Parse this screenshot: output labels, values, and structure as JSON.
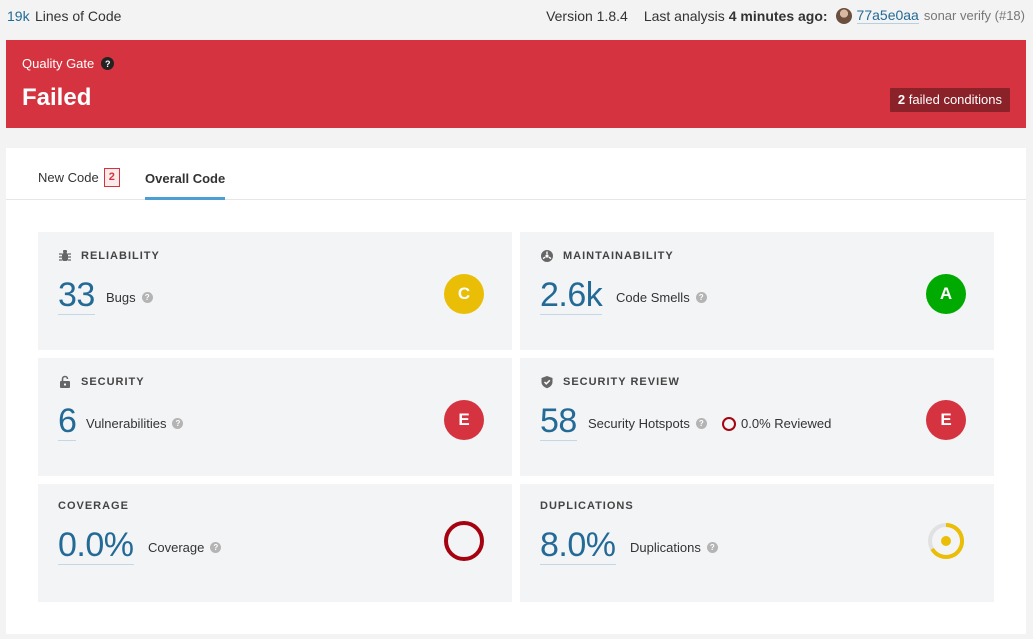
{
  "topbar": {
    "loc_value": "19k",
    "loc_label": "Lines of Code",
    "version": "Version 1.8.4",
    "last_analysis_label": "Last analysis",
    "last_analysis_ago": "4 minutes ago:",
    "commit": "77a5e0aa",
    "branch_note": "sonar verify (#18)",
    "avatar_icon": "user-avatar"
  },
  "quality_gate": {
    "label": "Quality Gate",
    "help": "?",
    "status": "Failed",
    "failed_count": "2",
    "failed_text": "failed conditions",
    "color": "#d4333f"
  },
  "tabs": {
    "new_code": "New Code",
    "new_code_badge": "2",
    "overall_code": "Overall Code",
    "active": "overall_code"
  },
  "cards": {
    "reliability": {
      "title": "RELIABILITY",
      "icon": "bug-icon",
      "value": "33",
      "label": "Bugs",
      "rating": "C",
      "rating_color": "#eabe06"
    },
    "maintainability": {
      "title": "MAINTAINABILITY",
      "icon": "smell-icon",
      "value": "2.6k",
      "label": "Code Smells",
      "rating": "A",
      "rating_color": "#00aa00"
    },
    "security": {
      "title": "SECURITY",
      "icon": "lock-icon",
      "value": "6",
      "label": "Vulnerabilities",
      "rating": "E",
      "rating_color": "#d4333f"
    },
    "security_review": {
      "title": "SECURITY REVIEW",
      "icon": "shield-icon",
      "value": "58",
      "label": "Security Hotspots",
      "reviewed": "0.0% Reviewed",
      "rating": "E",
      "rating_color": "#d4333f"
    },
    "coverage": {
      "title": "COVERAGE",
      "value": "0.0%",
      "label": "Coverage",
      "coverage_fraction": 0.0
    },
    "duplications": {
      "title": "DUPLICATIONS",
      "value": "8.0%",
      "label": "Duplications",
      "duplication_fraction": 0.08
    }
  }
}
